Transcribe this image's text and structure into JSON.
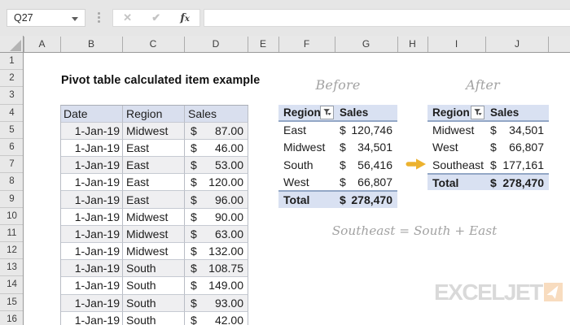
{
  "currency": "$",
  "chrome": {
    "name_box_value": "Q27",
    "formula_bar_value": "",
    "cancel_glyph": "✕",
    "enter_glyph": "✔",
    "fx_f": "f",
    "fx_x": "x"
  },
  "grid": {
    "column_letters": [
      "A",
      "B",
      "C",
      "D",
      "E",
      "F",
      "G",
      "H",
      "I",
      "J"
    ],
    "row_numbers": [
      "1",
      "2",
      "3",
      "4",
      "5",
      "6",
      "7",
      "8",
      "9",
      "10",
      "11",
      "12",
      "13",
      "14",
      "15",
      "16"
    ]
  },
  "title": "Pivot table calculated item example",
  "data_table": {
    "headers": {
      "date": "Date",
      "region": "Region",
      "sales": "Sales"
    },
    "rows": [
      {
        "date": "1-Jan-19",
        "region": "Midwest",
        "amount": "87.00"
      },
      {
        "date": "1-Jan-19",
        "region": "East",
        "amount": "46.00"
      },
      {
        "date": "1-Jan-19",
        "region": "East",
        "amount": "53.00"
      },
      {
        "date": "1-Jan-19",
        "region": "East",
        "amount": "120.00"
      },
      {
        "date": "1-Jan-19",
        "region": "East",
        "amount": "96.00"
      },
      {
        "date": "1-Jan-19",
        "region": "Midwest",
        "amount": "90.00"
      },
      {
        "date": "1-Jan-19",
        "region": "Midwest",
        "amount": "63.00"
      },
      {
        "date": "1-Jan-19",
        "region": "Midwest",
        "amount": "132.00"
      },
      {
        "date": "1-Jan-19",
        "region": "South",
        "amount": "108.75"
      },
      {
        "date": "1-Jan-19",
        "region": "South",
        "amount": "149.00"
      },
      {
        "date": "1-Jan-19",
        "region": "South",
        "amount": "93.00"
      },
      {
        "date": "1-Jan-19",
        "region": "South",
        "amount": "42.00"
      }
    ]
  },
  "before_pivot": {
    "label": "Before",
    "headers": {
      "region": "Region",
      "sales": "Sales"
    },
    "rows": [
      {
        "region": "East",
        "amount": "120,746"
      },
      {
        "region": "Midwest",
        "amount": "34,501"
      },
      {
        "region": "South",
        "amount": "56,416"
      },
      {
        "region": "West",
        "amount": "66,807"
      }
    ],
    "total": {
      "label": "Total",
      "amount": "278,470"
    }
  },
  "after_pivot": {
    "label": "After",
    "headers": {
      "region": "Region",
      "sales": "Sales"
    },
    "rows": [
      {
        "region": "Midwest",
        "amount": "34,501"
      },
      {
        "region": "West",
        "amount": "66,807"
      },
      {
        "region": "Southeast",
        "amount": "177,161"
      }
    ],
    "total": {
      "label": "Total",
      "amount": "278,470"
    }
  },
  "note": "Southeast = South + East",
  "logo_text": "EXCELJET",
  "colors": {
    "pivot_header_fill": "#d9e1f2",
    "pivot_border": "#93a7c6",
    "table_header_fill": "#d9dfee",
    "band_fill": "#efeff1",
    "arrow_orange": "#ecb22e",
    "logo_orange": "#f8dcbf",
    "script_gray": "#a2a2a2",
    "chrome_gray": "#e6e6e6"
  }
}
